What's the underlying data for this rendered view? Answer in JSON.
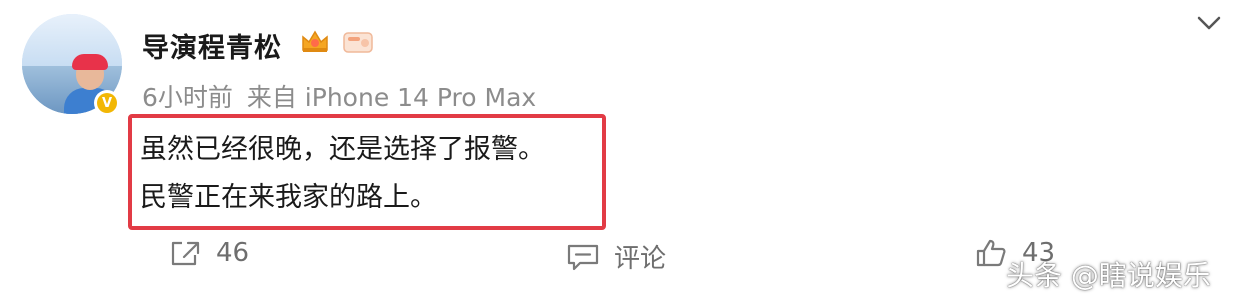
{
  "post": {
    "author": "导演程青松",
    "time": "6小时前",
    "source": "来自 iPhone 14 Pro Max",
    "content_line1": "虽然已经很晚，还是选择了报警。",
    "content_line2": "民警正在来我家的路上。"
  },
  "actions": {
    "repost_count": "46",
    "comment_label": "评论",
    "like_count": "4​3"
  },
  "watermark": "头条 @瞎说娱乐",
  "colors": {
    "highlight_border": "#e23b45",
    "verified_badge": "#f2b705",
    "muted_text": "#8c8c8c"
  },
  "icons": [
    "crown-badge-icon",
    "card-badge-icon",
    "verified-badge-icon",
    "chevron-down-icon",
    "repost-icon",
    "comment-icon",
    "like-icon"
  ]
}
